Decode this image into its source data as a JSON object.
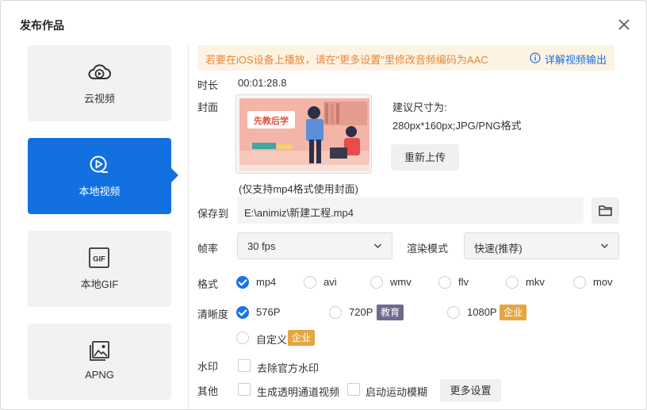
{
  "dialog": {
    "title": "发布作品"
  },
  "sidebar": {
    "items": [
      {
        "label": "云视频",
        "icon": "cloud-play-icon",
        "active": false
      },
      {
        "label": "本地视频",
        "icon": "local-video-icon",
        "active": true
      },
      {
        "label": "本地GIF",
        "icon": "gif-icon",
        "active": false
      },
      {
        "label": "APNG",
        "icon": "image-icon",
        "active": false
      }
    ]
  },
  "notice": {
    "message": "若要在iOS设备上播放，请在\"更多设置\"里修改音频编码为AAC",
    "link": "详解视频输出"
  },
  "form": {
    "duration_label": "时长",
    "duration_value": "00:01:28.8",
    "cover_label": "封面",
    "cover_hint_line1": "建议尺寸为:",
    "cover_hint_line2": "280px*160px;JPG/PNG格式",
    "reupload_button": "重新上传",
    "cover_note": "(仅支持mp4格式使用封面)",
    "cover_image_text": "先教后学",
    "save_label": "保存到",
    "save_path": "E:\\animiz\\新建工程.mp4",
    "fps_label": "帧率",
    "fps_value": "30 fps",
    "render_label": "渲染模式",
    "render_value": "快速(推荐)",
    "format_label": "格式",
    "formats": [
      {
        "label": "mp4",
        "selected": true
      },
      {
        "label": "avi",
        "selected": false
      },
      {
        "label": "wmv",
        "selected": false
      },
      {
        "label": "flv",
        "selected": false
      },
      {
        "label": "mkv",
        "selected": false
      },
      {
        "label": "mov",
        "selected": false
      }
    ],
    "quality_label": "清晰度",
    "qualities": [
      {
        "label": "576P",
        "selected": true,
        "badge": ""
      },
      {
        "label": "720P",
        "selected": false,
        "badge": "教育"
      },
      {
        "label": "1080P",
        "selected": false,
        "badge": "企业"
      },
      {
        "label": "自定义",
        "selected": false,
        "badge": "企业"
      }
    ],
    "watermark_label": "水印",
    "watermark_option": "去除官方水印",
    "other_label": "其他",
    "other_option1": "生成透明通道视频",
    "other_option2": "启动运动模糊",
    "more_settings": "更多设置"
  },
  "colors": {
    "accent": "#1270e0",
    "notice_text": "#e8883a",
    "notice_bg": "#fdf3e3",
    "badge_edu": "#6e6a8e",
    "badge_ent": "#e3a742"
  }
}
